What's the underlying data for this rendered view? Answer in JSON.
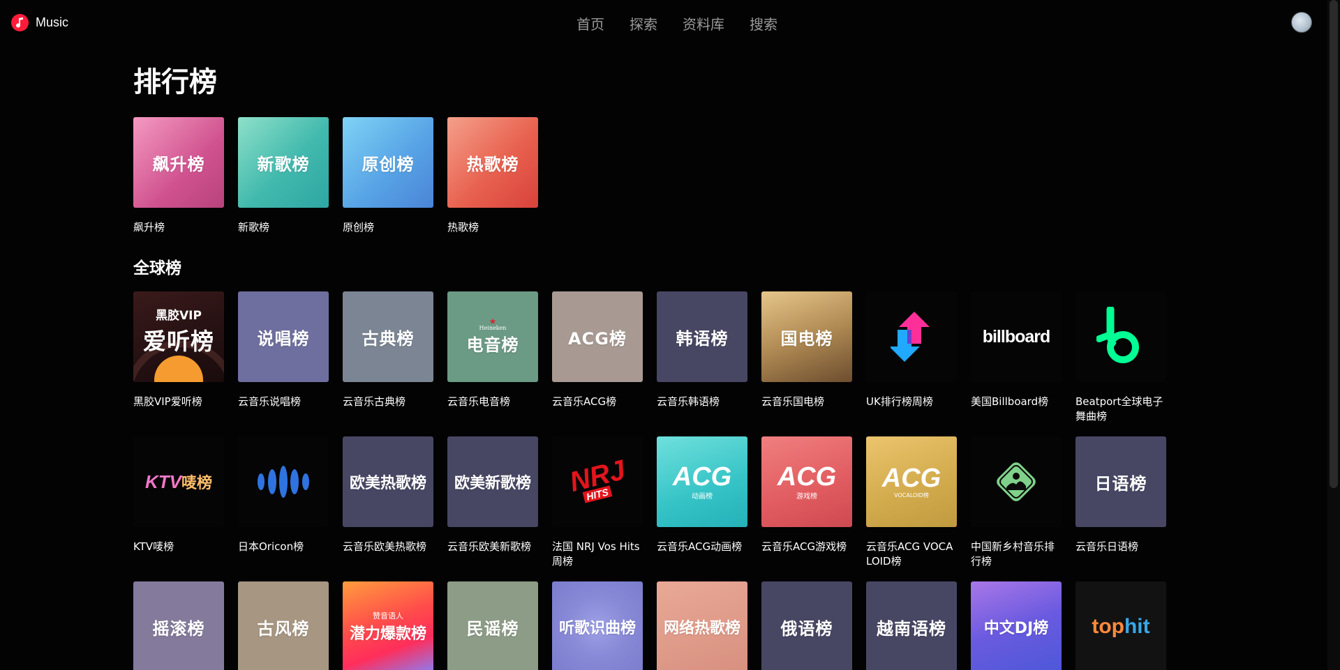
{
  "app": {
    "name": "Music"
  },
  "nav": [
    "首页",
    "探索",
    "资料库",
    "搜索"
  ],
  "page_title": "排行榜",
  "featured": [
    {
      "label": "飙升榜",
      "title": "飙升榜"
    },
    {
      "label": "新歌榜",
      "title": "新歌榜"
    },
    {
      "label": "原创榜",
      "title": "原创榜"
    },
    {
      "label": "热歌榜",
      "title": "热歌榜"
    }
  ],
  "global_title": "全球榜",
  "global_row1": [
    {
      "cover": "",
      "title": "黑胶VIP爱听榜",
      "art": "黑胶VIP 爱听榜"
    },
    {
      "cover": "说唱榜",
      "title": "云音乐说唱榜"
    },
    {
      "cover": "古典榜",
      "title": "云音乐古典榜"
    },
    {
      "cover": "电音榜",
      "title": "云音乐电音榜",
      "art": "Heineken"
    },
    {
      "cover": "ACG榜",
      "title": "云音乐ACG榜"
    },
    {
      "cover": "韩语榜",
      "title": "云音乐韩语榜"
    },
    {
      "cover": "国电榜",
      "title": "云音乐国电榜"
    },
    {
      "cover": "",
      "title": "UK排行榜周榜"
    },
    {
      "cover": "billboard",
      "title": "美国Billboard榜"
    },
    {
      "cover": "",
      "title": "Beatport全球电子舞曲榜"
    }
  ],
  "global_row2": [
    {
      "cover": "KTV",
      "cover2": "唛榜",
      "title": "KTV唛榜"
    },
    {
      "cover": "",
      "title": "日本Oricon榜"
    },
    {
      "cover": "欧美热歌榜",
      "title": "云音乐欧美热歌榜"
    },
    {
      "cover": "欧美新歌榜",
      "title": "云音乐欧美新歌榜"
    },
    {
      "cover": "NRJ",
      "cover2": "HITS",
      "title": "法国 NRJ Vos Hits 周榜"
    },
    {
      "cover": "ACG",
      "cover2": "动画榜",
      "title": "云音乐ACG动画榜"
    },
    {
      "cover": "ACG",
      "cover2": "游戏榜",
      "title": "云音乐ACG游戏榜"
    },
    {
      "cover": "ACG",
      "cover2": "VOCALOID榜",
      "title": "云音乐ACG VOCALOID榜"
    },
    {
      "cover": "",
      "title": "中国新乡村音乐排行榜"
    },
    {
      "cover": "日语榜",
      "title": "云音乐日语榜"
    }
  ],
  "global_row3": [
    {
      "cover": "摇滚榜"
    },
    {
      "cover": "古风榜"
    },
    {
      "cover": "潜力爆款榜",
      "cover2": "赞音语人"
    },
    {
      "cover": "民谣榜"
    },
    {
      "cover": "听歌识曲榜"
    },
    {
      "cover": "网络热歌榜"
    },
    {
      "cover": "俄语榜"
    },
    {
      "cover": "越南语榜"
    },
    {
      "cover": "中文DJ榜"
    },
    {
      "cover": "top",
      "cover2": "hit"
    }
  ],
  "colors": {
    "accent": "#ff1c3a",
    "nav_text": "#9a9a9a",
    "background": "#030303"
  }
}
